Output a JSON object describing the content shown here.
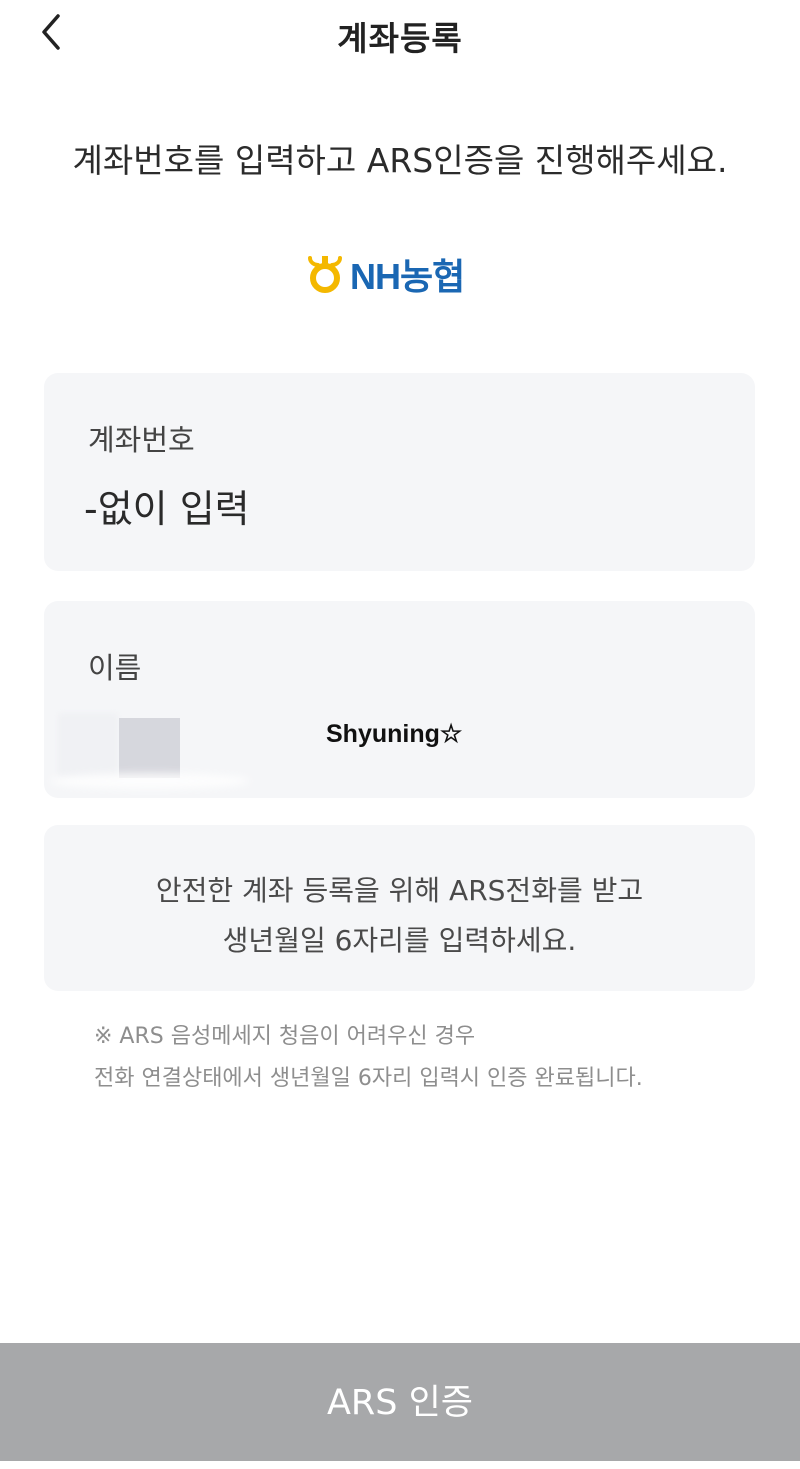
{
  "header": {
    "back_icon": "chevron-left-icon",
    "title": "계좌등록"
  },
  "instruction": "계좌번호를 입력하고 ARS인증을 진행해주세요.",
  "bank": {
    "logo_text": "NH농협",
    "logo_icon": "nh-bank-logo-icon",
    "brand_color": "#1a67b3",
    "icon_color": "#f4b800"
  },
  "account_field": {
    "label": "계좌번호",
    "placeholder": "-없이 입력",
    "value": ""
  },
  "name_field": {
    "label": "이름",
    "overlay_text": "Shyuning☆"
  },
  "notice": {
    "line1": "안전한 계좌 등록을 위해 ARS전화를 받고",
    "line2": "생년월일 6자리를 입력하세요."
  },
  "footnote": {
    "line1": "※ ARS 음성메세지 청음이 어려우신 경우",
    "line2": "전화 연결상태에서 생년월일 6자리 입력시 인증 완료됩니다."
  },
  "submit_button": {
    "label": "ARS 인증",
    "bg_color": "#a7a8aa"
  }
}
